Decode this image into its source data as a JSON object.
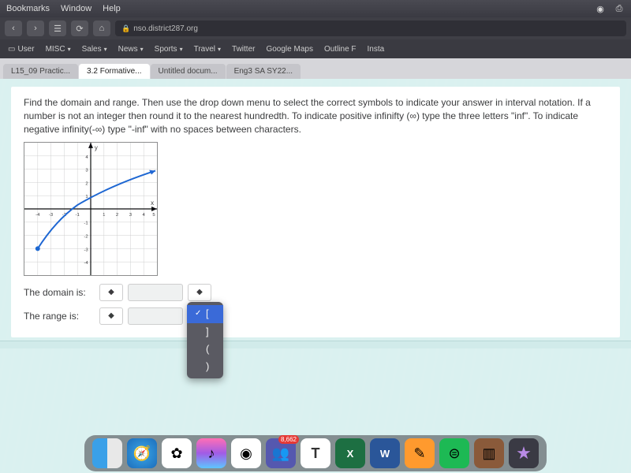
{
  "menubar": {
    "items": [
      "Bookmarks",
      "Window",
      "Help"
    ]
  },
  "browser": {
    "address": "nso.district287.org"
  },
  "bookmarks": {
    "user": "User",
    "folders": [
      "MISC",
      "Sales",
      "News",
      "Sports",
      "Travel"
    ],
    "links": [
      "Twitter",
      "Google Maps",
      "Outline F",
      "Insta"
    ]
  },
  "tabs": [
    "L15_09 Practic...",
    "3.2 Formative...",
    "Untitled docum...",
    "Eng3 SA SY22..."
  ],
  "question": {
    "text": "Find the domain and range. Then use the drop down menu to select the correct symbols to indicate your answer in interval notation. If a number is not an integer then round it to the nearest hundredth. To indicate positive infinifty (∞) type the three letters \"inf\". To indicate negative infinity(-∞) type \"-inf\" with no spaces between characters.",
    "axis_y_label": "y",
    "axis_x_label": "x",
    "domain_label": "The domain is:",
    "range_label": "The range is:",
    "select_glyph": "◆"
  },
  "dropdown": {
    "items": [
      "[",
      "]",
      "(",
      ")"
    ],
    "selected_index": 0
  },
  "chart_data": {
    "type": "line",
    "title": "",
    "xlabel": "x",
    "ylabel": "y",
    "xlim": [
      -5,
      5
    ],
    "ylim": [
      -5,
      5
    ],
    "x_ticks": [
      -5,
      -4,
      -3,
      -2,
      -1,
      1,
      2,
      3,
      4,
      5
    ],
    "y_ticks": [
      -5,
      -4,
      -3,
      -2,
      -1,
      1,
      2,
      3,
      4,
      5
    ],
    "series": [
      {
        "name": "curve",
        "x": [
          -4,
          -3,
          -2,
          -1,
          0,
          1,
          2,
          3,
          4,
          5
        ],
        "y": [
          -3,
          -1.4,
          -0.3,
          0.5,
          1.1,
          1.6,
          2.0,
          2.35,
          2.65,
          2.9
        ],
        "left_endpoint": {
          "x": -4,
          "y": -3,
          "closed": true
        }
      }
    ]
  },
  "dock": {
    "badge_count": "8,662",
    "excel_label": "X",
    "word_label": "W",
    "t_label": "T"
  }
}
